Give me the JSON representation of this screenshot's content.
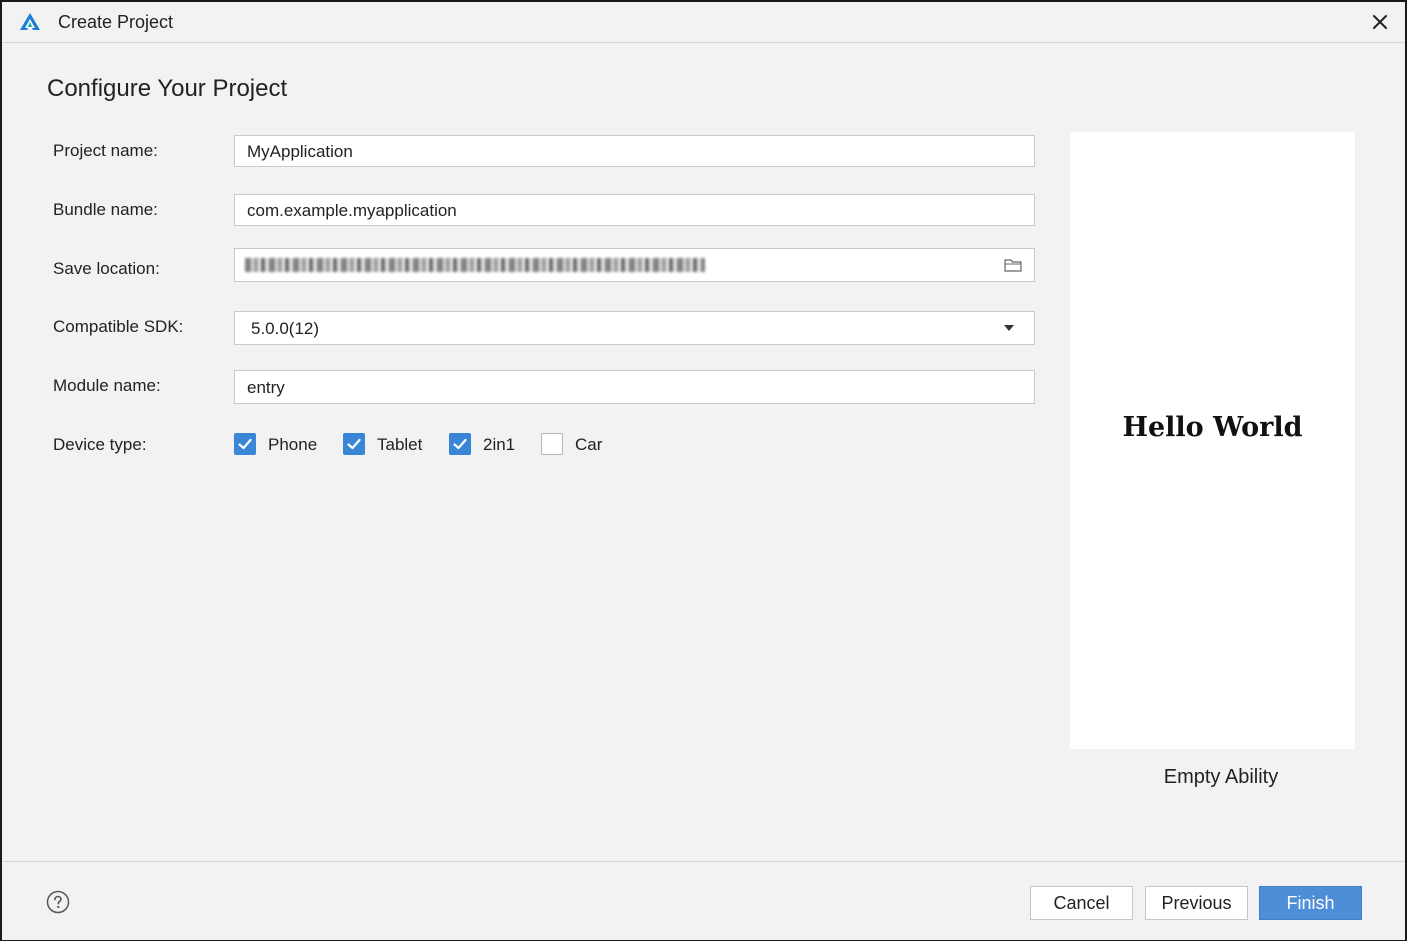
{
  "window": {
    "title": "Create Project"
  },
  "page": {
    "heading": "Configure Your Project"
  },
  "form": {
    "project_name": {
      "label": "Project name:",
      "value": "MyApplication"
    },
    "bundle_name": {
      "label": "Bundle name:",
      "value": "com.example.myapplication"
    },
    "save_location": {
      "label": "Save location:"
    },
    "compatible_sdk": {
      "label": "Compatible SDK:",
      "value": "5.0.0(12)"
    },
    "module_name": {
      "label": "Module name:",
      "value": "entry"
    },
    "device_type": {
      "label": "Device type:",
      "options": [
        {
          "label": "Phone",
          "checked": true
        },
        {
          "label": "Tablet",
          "checked": true
        },
        {
          "label": "2in1",
          "checked": true
        },
        {
          "label": "Car",
          "checked": false
        }
      ]
    }
  },
  "preview": {
    "text": "Hello World",
    "template_name": "Empty Ability"
  },
  "footer": {
    "cancel": "Cancel",
    "previous": "Previous",
    "finish": "Finish"
  },
  "colors": {
    "accent": "#3a86d6",
    "primary_button": "#4e8ed8",
    "background": "#f2f2f2"
  },
  "icons": [
    "app-logo-icon",
    "close-icon",
    "folder-icon",
    "chevron-down-icon",
    "check-icon",
    "help-icon"
  ]
}
